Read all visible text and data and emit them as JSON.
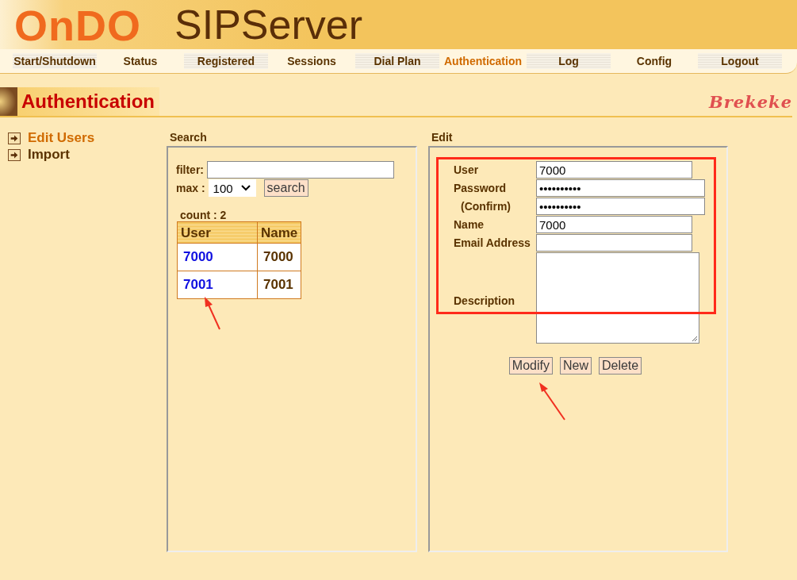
{
  "header": {
    "logo": "OnDO",
    "product": "SIPServer",
    "brand": "Brekeke"
  },
  "nav": [
    {
      "label": "Start/Shutdown",
      "selected": false
    },
    {
      "label": "Status",
      "selected": false
    },
    {
      "label": "Registered",
      "selected": false
    },
    {
      "label": "Sessions",
      "selected": false
    },
    {
      "label": "Dial Plan",
      "selected": false
    },
    {
      "label": "Authentication",
      "selected": true
    },
    {
      "label": "Log",
      "selected": false
    },
    {
      "label": "Config",
      "selected": false
    },
    {
      "label": "Logout",
      "selected": false
    }
  ],
  "page_title": "Authentication",
  "sidebar": {
    "items": [
      {
        "label": "Edit Users",
        "selected": true
      },
      {
        "label": "Import",
        "selected": false
      }
    ]
  },
  "search": {
    "legend": "Search",
    "filter_label": "filter:",
    "max_label": "max :",
    "max_value": "100",
    "search_button": "search",
    "count": "count : 2",
    "table": {
      "columns": [
        "User",
        "Name"
      ],
      "rows": [
        [
          "7000",
          "7000"
        ],
        [
          "7001",
          "7001"
        ]
      ]
    }
  },
  "edit": {
    "legend": "Edit",
    "fields": [
      {
        "label": "User",
        "value": "7000",
        "kind": "text"
      },
      {
        "label": "Password",
        "value": "••••••••••",
        "kind": "wide"
      },
      {
        "label": "(Confirm)",
        "value": "••••••••••",
        "kind": "wide"
      },
      {
        "label": "Name",
        "value": "7000",
        "kind": "text"
      },
      {
        "label": "Email Address",
        "kind": "text"
      },
      {
        "label": "Description",
        "kind": "textarea"
      }
    ],
    "buttons": [
      "Modify",
      "New",
      "Delete"
    ]
  }
}
